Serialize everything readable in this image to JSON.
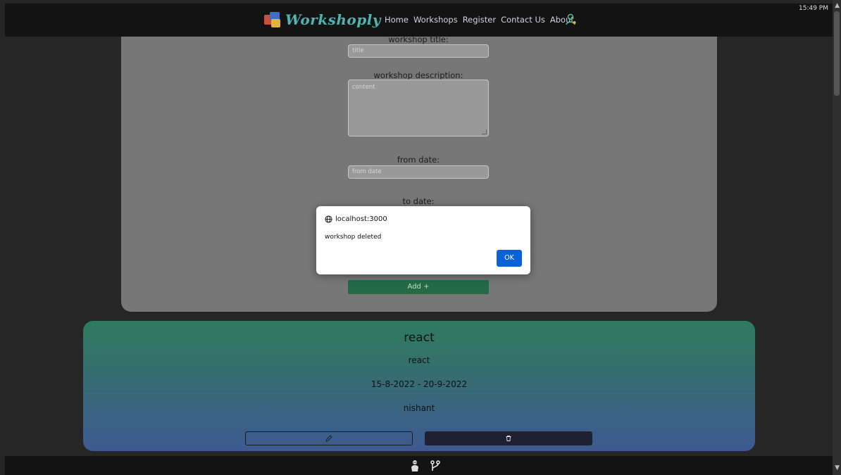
{
  "nav": {
    "brand": "Workshoply",
    "links": [
      "Home",
      "Workshops",
      "Register",
      "Contact Us",
      "About"
    ],
    "clock": "15:49 PM"
  },
  "form": {
    "title_label": "workshop title:",
    "title_placeholder": "title",
    "description_label": "workshop description:",
    "description_placeholder": "content",
    "from_label": "from date:",
    "from_placeholder": "from date",
    "to_label": "to date:",
    "add_button": "Add +"
  },
  "card": {
    "title": "react",
    "description": "react",
    "dates": "15-8-2022 - 20-9-2022",
    "author": "nishant"
  },
  "dialog": {
    "origin": "localhost:3000",
    "message": "workshop deleted",
    "ok": "OK"
  }
}
